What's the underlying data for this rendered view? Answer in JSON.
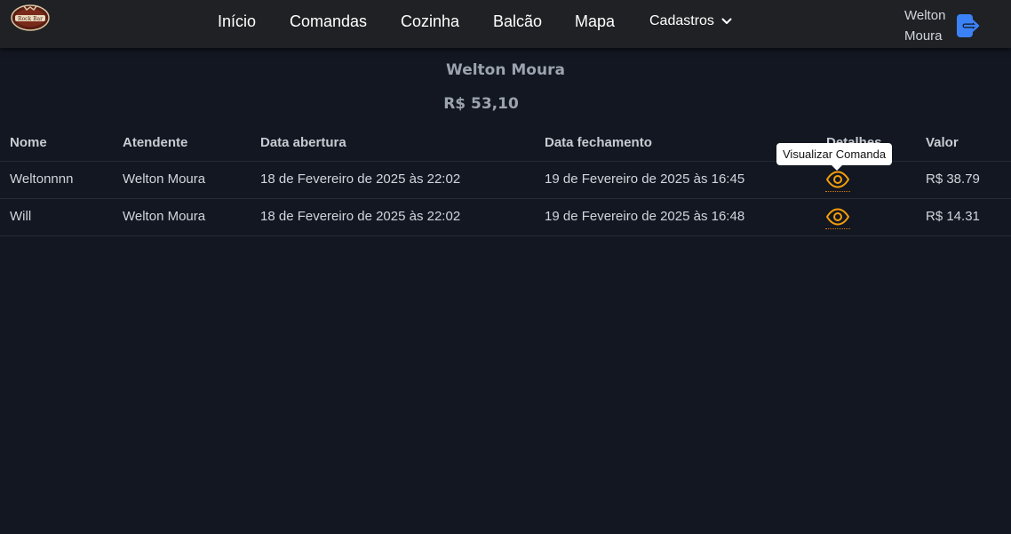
{
  "app": {
    "logo_text": "Rock Bar"
  },
  "nav": {
    "links": [
      "Início",
      "Comandas",
      "Cozinha",
      "Balcão",
      "Mapa"
    ],
    "dropdown_label": "Cadastros",
    "user_name": "Welton Moura"
  },
  "summary": {
    "name": "Welton Moura",
    "total": "R$ 53,10"
  },
  "table": {
    "headers": [
      "Nome",
      "Atendente",
      "Data abertura",
      "Data fechamento",
      "Detalhes",
      "Valor"
    ],
    "rows": [
      {
        "nome": "Weltonnnn",
        "atendente": "Welton Moura",
        "abertura": "18 de Fevereiro de 2025 às 22:02",
        "fechamento": "19 de Fevereiro de 2025 às 16:45",
        "valor": "R$ 38.79"
      },
      {
        "nome": "Will",
        "atendente": "Welton Moura",
        "abertura": "18 de Fevereiro de 2025 às 22:02",
        "fechamento": "19 de Fevereiro de 2025 às 16:48",
        "valor": "R$ 14.31"
      }
    ]
  },
  "tooltip": {
    "text": "Visualizar Comanda"
  },
  "icons": {
    "logo": "rock-bar-logo",
    "dropdown": "chevron-down-icon",
    "logout": "logout-icon",
    "details": "eye-icon"
  },
  "colors": {
    "background": "#121721",
    "navbar": "#1f2124",
    "accent_logout": "#3b82f6",
    "accent_eye": "#f59e0b"
  }
}
